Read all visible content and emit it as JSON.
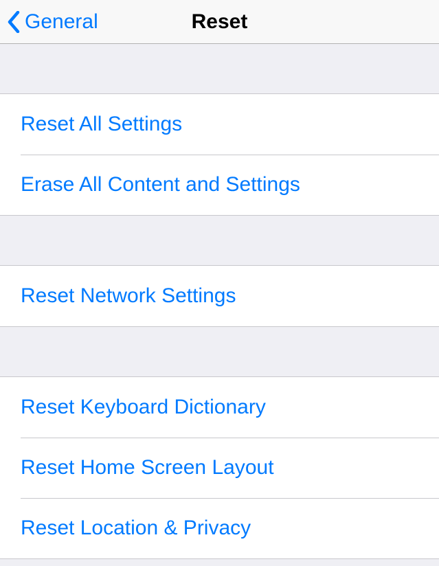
{
  "navbar": {
    "back_label": "General",
    "title": "Reset"
  },
  "groups": [
    {
      "items": [
        {
          "label": "Reset All Settings",
          "name": "reset-all-settings"
        },
        {
          "label": "Erase All Content and Settings",
          "name": "erase-all-content"
        }
      ]
    },
    {
      "items": [
        {
          "label": "Reset Network Settings",
          "name": "reset-network-settings"
        }
      ]
    },
    {
      "items": [
        {
          "label": "Reset Keyboard Dictionary",
          "name": "reset-keyboard-dictionary"
        },
        {
          "label": "Reset Home Screen Layout",
          "name": "reset-home-screen-layout"
        },
        {
          "label": "Reset Location & Privacy",
          "name": "reset-location-privacy"
        }
      ]
    }
  ]
}
